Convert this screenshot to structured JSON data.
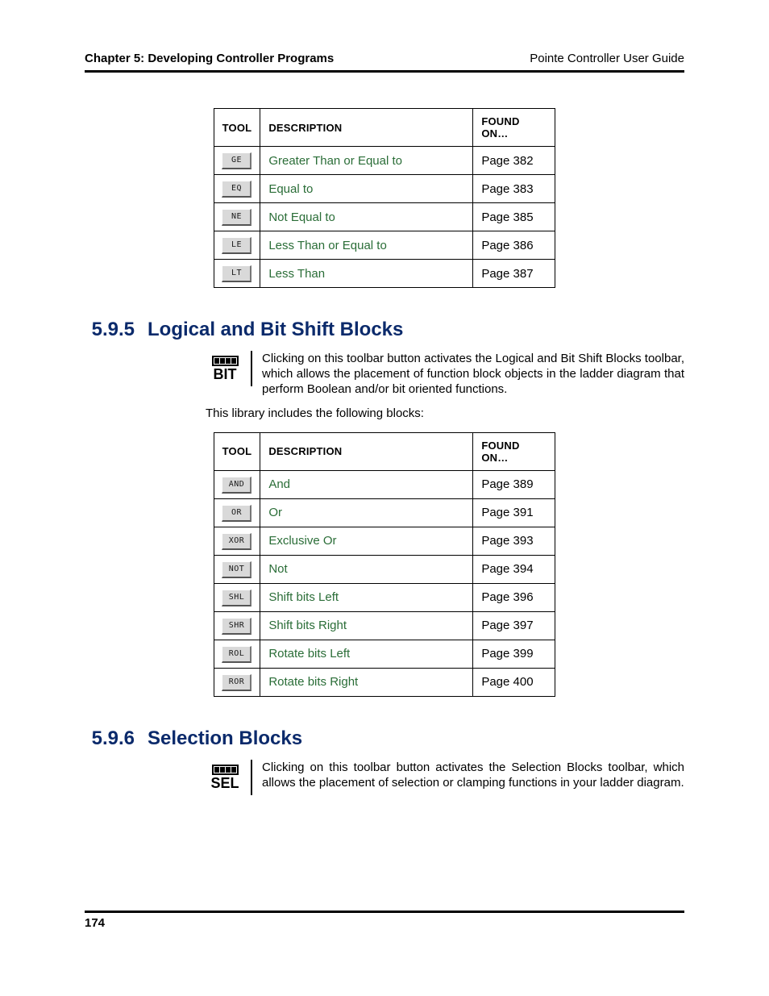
{
  "header": {
    "left": "Chapter 5: Developing Controller Programs",
    "right": "Pointe Controller User Guide"
  },
  "table_headers": {
    "tool": "TOOL",
    "description": "DESCRIPTION",
    "found_on": "FOUND ON…"
  },
  "table1": {
    "rows": [
      {
        "button": "GE",
        "desc": "Greater Than or Equal to",
        "page": "Page 382"
      },
      {
        "button": "EQ",
        "desc": "Equal to",
        "page": "Page 383"
      },
      {
        "button": "NE",
        "desc": "Not Equal to",
        "page": "Page 385"
      },
      {
        "button": "LE",
        "desc": "Less Than or Equal to",
        "page": "Page 386"
      },
      {
        "button": "LT",
        "desc": "Less Than",
        "page": "Page 387"
      }
    ]
  },
  "section595": {
    "number": "5.9.5",
    "title": "Logical and Bit Shift Blocks",
    "icon_label": "BIT",
    "para": "Clicking on this toolbar button activates the Logical and Bit Shift Blocks toolbar, which allows the placement of function block objects in the ladder diagram that perform Boolean and/or bit oriented functions.",
    "intro": "This library includes the following blocks:"
  },
  "table2": {
    "rows": [
      {
        "button": "AND",
        "desc": "And",
        "page": "Page 389"
      },
      {
        "button": "OR",
        "desc": "Or",
        "page": "Page 391"
      },
      {
        "button": "XOR",
        "desc": "Exclusive Or",
        "page": "Page 393"
      },
      {
        "button": "NOT",
        "desc": "Not",
        "page": "Page 394"
      },
      {
        "button": "SHL",
        "desc": "Shift bits Left",
        "page": "Page 396"
      },
      {
        "button": "SHR",
        "desc": "Shift bits Right",
        "page": "Page 397"
      },
      {
        "button": "ROL",
        "desc": "Rotate bits Left",
        "page": "Page 399"
      },
      {
        "button": "ROR",
        "desc": "Rotate bits Right",
        "page": "Page 400"
      }
    ]
  },
  "section596": {
    "number": "5.9.6",
    "title": "Selection Blocks",
    "icon_label": "SEL",
    "para": "Clicking on this toolbar button activates the Selection Blocks toolbar, which allows the placement of selection or clamping functions in your ladder diagram."
  },
  "footer": {
    "page_number": "174"
  }
}
